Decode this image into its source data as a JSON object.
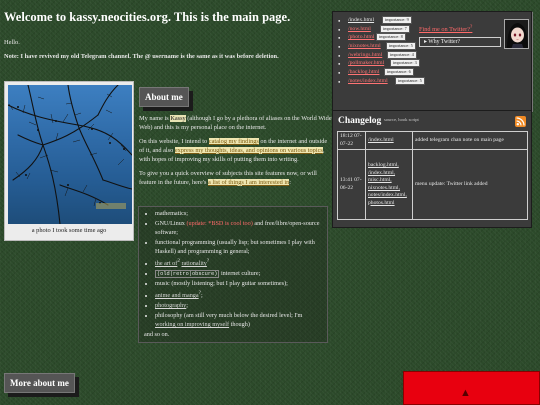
{
  "page": {
    "title": "Welcome to kassy.neocities.org. This is the main page.",
    "hello": "Hello.",
    "note": "Note: I have revived my old Telegram channel. The @ username is the same as it was before deletion."
  },
  "photo": {
    "caption": "a photo I took some time ago"
  },
  "about": {
    "heading": "About me",
    "p1_a": "My name is ",
    "p1_name": "Kassy",
    "p1_b": " (although I go by a plethora of aliases on the World Wide Web) and this is my personal place on the internet.",
    "p2_a": "On this website, I intend to ",
    "p2_link1": "catalog my findings",
    "p2_b": " on the internet and outside of it, and also ",
    "p2_link2": "express my thoughts, ideas, and opinions on various topics",
    "p2_c": ", with hopes of improving my skills of putting them into writing.",
    "p3_a": "To give you a quick overview of subjects this site features now, or will feature in the future, here's ",
    "p3_link": "a list of things I am interested in",
    "p3_b": ":"
  },
  "interests": {
    "i1": "mathematics;",
    "i2_a": "GNU/Linux ",
    "i2_red": "(update: *BSD is cool too)",
    "i2_b": " and free/libre/open-source software;",
    "i3": "functional programming (usually lisp; but sometimes I play with Haskell) and programming in general;",
    "i4_link1": "the art of",
    "i4_sup": "2",
    "i4_link2": "rationality",
    "i4_sup2": "?",
    "i5_mono": "(old|retro|obscure)",
    "i5_b": " internet culture;",
    "i6": "music (mostly listening; but I play guitar sometimes);",
    "i7_link": "anime and manga",
    "i7_sup": "?",
    "i7_b": ";",
    "i8_link": "photography",
    "i8_b": ";",
    "i9_a": "philosophy (am still very much below the desired level; I'm ",
    "i9_link": "working on improving myself",
    "i9_b": " though)",
    "i10": "and so on."
  },
  "nav": {
    "items": [
      {
        "label": "/index.html",
        "importance": "importance: 9"
      },
      {
        "label": "/now.html",
        "importance": "importance: 7"
      },
      {
        "label": "/photo.html",
        "importance": "importance: 8"
      },
      {
        "label": "/nixnotes.html",
        "importance": "importance: 5"
      },
      {
        "label": "/webrings.html",
        "importance": "importance: 4"
      },
      {
        "label": "/pollmaker.html",
        "importance: 9": "",
        "importance": "importance: 3"
      },
      {
        "label": "/backlog.html",
        "importance": "importance: 6"
      },
      {
        "label": "/notes/index.html",
        "importance": "importance: 5"
      }
    ],
    "twitter_link": "Find me on Twitter?",
    "twitter_sup": "?",
    "twitter_toggle": "Why Twitter?"
  },
  "changelog": {
    "title": "Changelog",
    "subtitle": "source, hook script",
    "rows": [
      {
        "date": "18:12 07-07-22",
        "files": [
          "/index.html"
        ],
        "desc": "added telegram chan note on main page"
      },
      {
        "date": "13:41 07-06-22",
        "files": [
          "backlog.html,",
          "/index.html,",
          "misc.html,",
          "nixnotes.html,",
          "notes/index.html,",
          "photos.html"
        ],
        "desc": "menu update: Twitter link added"
      }
    ]
  },
  "more_about": {
    "heading": "More about me"
  },
  "colors": {
    "background": "#2c4a2a",
    "link_red": "#ff6a6a",
    "highlight": "#efe6b0",
    "red_box": "#e8000f"
  }
}
